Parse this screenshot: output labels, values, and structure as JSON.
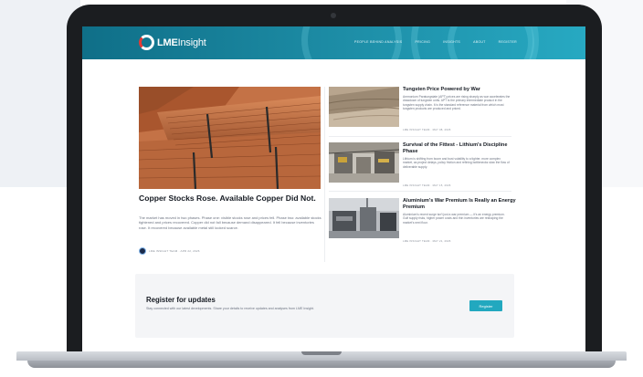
{
  "site": {
    "brand_bold": "LME",
    "brand_light": "Insight",
    "nav": [
      "PEOPLE BEHIND ANALYSIS",
      "PRICING",
      "INSIGHTS",
      "ABOUT",
      "REGISTER"
    ]
  },
  "feature": {
    "title": "Copper Stocks Rose. Available Copper Did Not.",
    "body": "The market has moved in two phases. Phase one: visible stocks rose and prices fell. Phase two: available stocks tightened and prices recovered. Copper did not fall because demand disappeared. It fell because inventories rose. It recovered because available metal still looked scarce.",
    "meta": "LME INSIGHT TEAM · APR 22, 2026"
  },
  "articles": [
    {
      "title": "Tungsten Price Powered by War",
      "body": "Ammonium Paratungstate (APT) prices are rising sharply as war accelerates the drawdown of tungsten units. APT is the primary intermediate product in the tungsten supply chain. It is the standard reference material from which most tungsten products are produced and priced.",
      "meta": "LME INSIGHT TEAM · MAY 08, 2026"
    },
    {
      "title": "Survival of the Fittest - Lithium's Discipline Phase",
      "body": "Lithium is shifting from boom and bust volatility to a tighter, more complex market, as project delays, policy friction and refining bottlenecks slow the flow of deliverable supply.",
      "meta": "LME INSIGHT TEAM · MAY 15, 2026"
    },
    {
      "title": "Aluminium's War Premium Is Really an Energy Premium",
      "body": "Aluminium's recent surge isn't just a war premium — it's an energy premium. Gulf supply risks, higher power costs and thin inventories are reshaping the market's next floor.",
      "meta": "LME INSIGHT TEAM · MAY 21, 2026"
    }
  ],
  "register": {
    "title": "Register for updates",
    "body": "Stay connected with our latest developments. Share your details to receive updates and analyses from LME Insight.",
    "button": "Register"
  },
  "colors": {
    "header_start": "#0f6f88",
    "header_end": "#27a9c2",
    "accent": "#22a8bf",
    "logo_red": "#e53935"
  }
}
